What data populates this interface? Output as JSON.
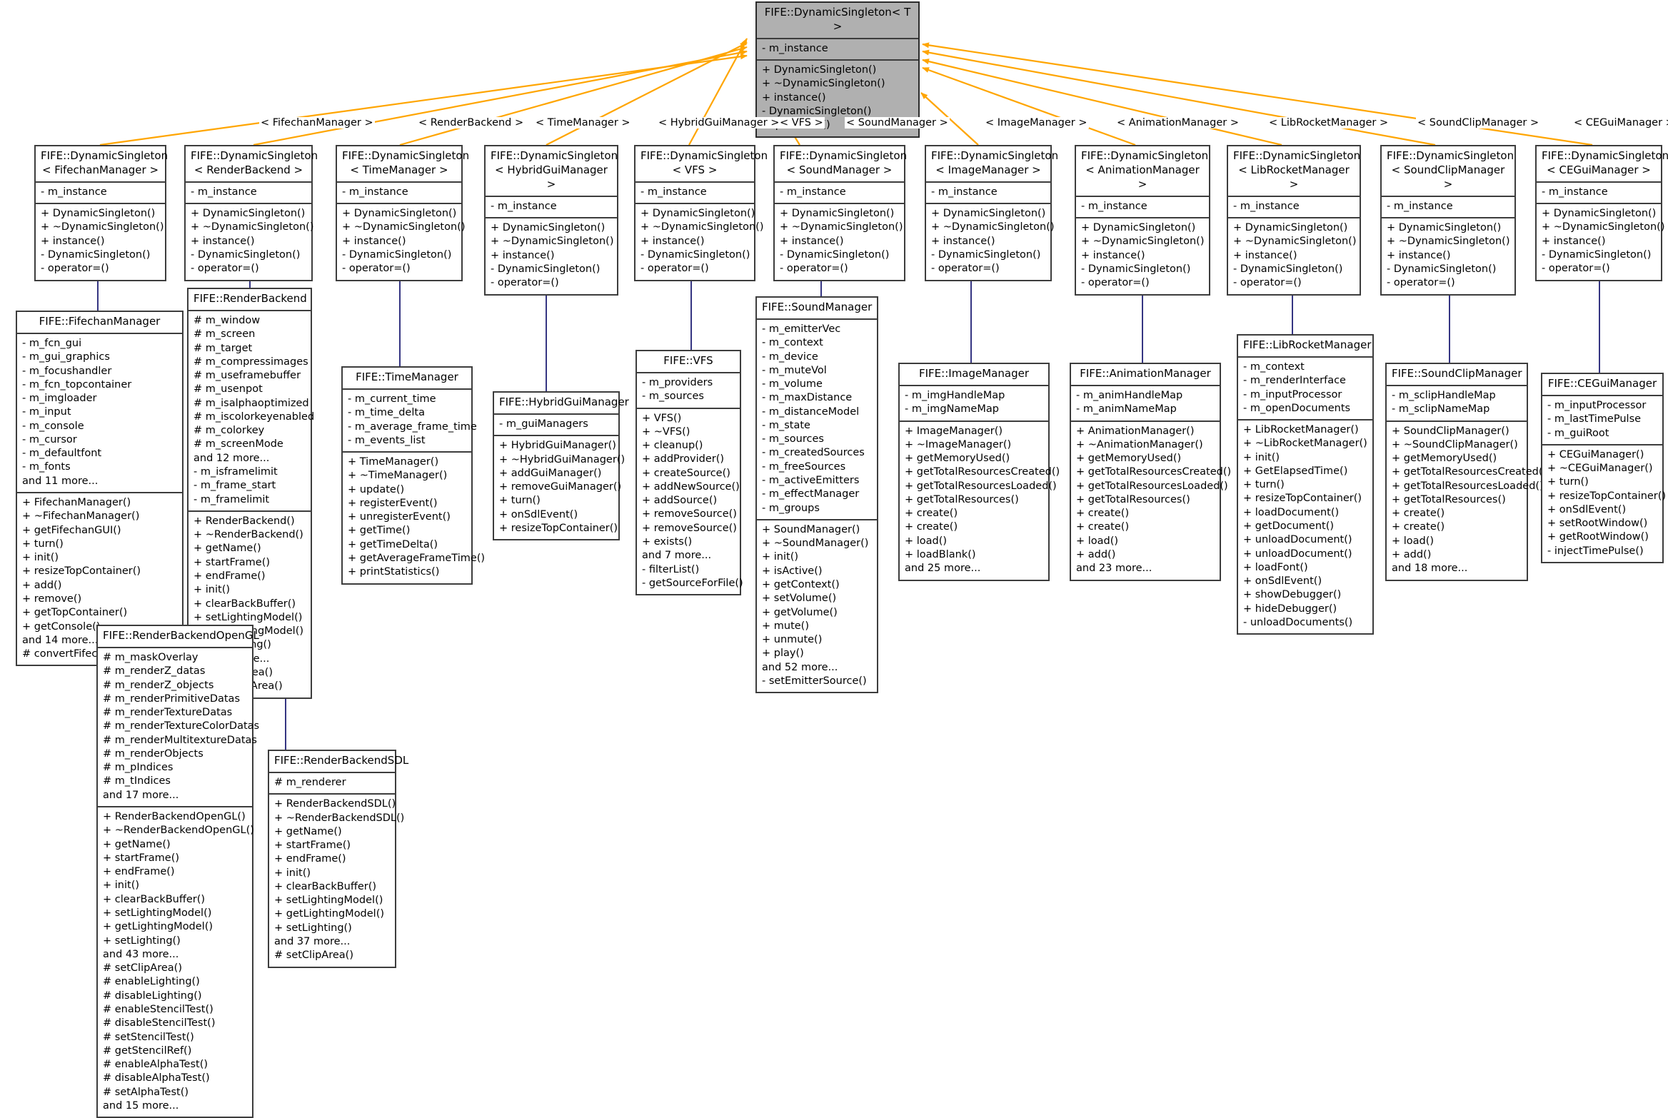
{
  "diagram": {
    "kind": "uml-inheritance-diagram",
    "colors": {
      "template_edge": "#ffa500",
      "inherit_edge": "#353582",
      "node_border": "#3d3d3d",
      "root_fill": "#b0b0b0",
      "node_fill": "#ffffff",
      "text": "#000000"
    }
  },
  "root": {
    "title": "FIFE::DynamicSingleton< T >",
    "attributes": [
      "- m_instance"
    ],
    "methods": [
      "+ DynamicSingleton()",
      "+ ~DynamicSingleton()",
      "+ instance()",
      "- DynamicSingleton()",
      "- operator=()"
    ]
  },
  "template_labels": [
    "< FifechanManager >",
    "< RenderBackend >",
    "< TimeManager >",
    "< HybridGuiManager >",
    "< VFS >",
    "< SoundManager >",
    "< ImageManager >",
    "< AnimationManager >",
    "< LibRocketManager >",
    "< SoundClipManager >",
    "< CEGuiManager >"
  ],
  "specializations": [
    {
      "title": "FIFE::DynamicSingleton\n< FifechanManager >",
      "attributes": [
        "- m_instance"
      ],
      "methods": [
        "+ DynamicSingleton()",
        "+ ~DynamicSingleton()",
        "+ instance()",
        "- DynamicSingleton()",
        "- operator=()"
      ]
    },
    {
      "title": "FIFE::DynamicSingleton\n< RenderBackend >",
      "attributes": [
        "- m_instance"
      ],
      "methods": [
        "+ DynamicSingleton()",
        "+ ~DynamicSingleton()",
        "+ instance()",
        "- DynamicSingleton()",
        "- operator=()"
      ]
    },
    {
      "title": "FIFE::DynamicSingleton\n< TimeManager >",
      "attributes": [
        "- m_instance"
      ],
      "methods": [
        "+ DynamicSingleton()",
        "+ ~DynamicSingleton()",
        "+ instance()",
        "- DynamicSingleton()",
        "- operator=()"
      ]
    },
    {
      "title": "FIFE::DynamicSingleton\n< HybridGuiManager >",
      "attributes": [
        "- m_instance"
      ],
      "methods": [
        "+ DynamicSingleton()",
        "+ ~DynamicSingleton()",
        "+ instance()",
        "- DynamicSingleton()",
        "- operator=()"
      ]
    },
    {
      "title": "FIFE::DynamicSingleton\n< VFS >",
      "attributes": [
        "- m_instance"
      ],
      "methods": [
        "+ DynamicSingleton()",
        "+ ~DynamicSingleton()",
        "+ instance()",
        "- DynamicSingleton()",
        "- operator=()"
      ]
    },
    {
      "title": "FIFE::DynamicSingleton\n< SoundManager >",
      "attributes": [
        "- m_instance"
      ],
      "methods": [
        "+ DynamicSingleton()",
        "+ ~DynamicSingleton()",
        "+ instance()",
        "- DynamicSingleton()",
        "- operator=()"
      ]
    },
    {
      "title": "FIFE::DynamicSingleton\n< ImageManager >",
      "attributes": [
        "- m_instance"
      ],
      "methods": [
        "+ DynamicSingleton()",
        "+ ~DynamicSingleton()",
        "+ instance()",
        "- DynamicSingleton()",
        "- operator=()"
      ]
    },
    {
      "title": "FIFE::DynamicSingleton\n< AnimationManager >",
      "attributes": [
        "- m_instance"
      ],
      "methods": [
        "+ DynamicSingleton()",
        "+ ~DynamicSingleton()",
        "+ instance()",
        "- DynamicSingleton()",
        "- operator=()"
      ]
    },
    {
      "title": "FIFE::DynamicSingleton\n< LibRocketManager >",
      "attributes": [
        "- m_instance"
      ],
      "methods": [
        "+ DynamicSingleton()",
        "+ ~DynamicSingleton()",
        "+ instance()",
        "- DynamicSingleton()",
        "- operator=()"
      ]
    },
    {
      "title": "FIFE::DynamicSingleton\n< SoundClipManager >",
      "attributes": [
        "- m_instance"
      ],
      "methods": [
        "+ DynamicSingleton()",
        "+ ~DynamicSingleton()",
        "+ instance()",
        "- DynamicSingleton()",
        "- operator=()"
      ]
    },
    {
      "title": "FIFE::DynamicSingleton\n< CEGuiManager >",
      "attributes": [
        "- m_instance"
      ],
      "methods": [
        "+ DynamicSingleton()",
        "+ ~DynamicSingleton()",
        "+ instance()",
        "- DynamicSingleton()",
        "- operator=()"
      ]
    }
  ],
  "classes": [
    {
      "id": "fifechanmanager",
      "title": "FIFE::FifechanManager",
      "attributes": [
        "- m_fcn_gui",
        "- m_gui_graphics",
        "- m_focushandler",
        "- m_fcn_topcontainer",
        "- m_imgloader",
        "- m_input",
        "- m_console",
        "- m_cursor",
        "- m_defaultfont",
        "- m_fonts",
        "and 11 more..."
      ],
      "methods": [
        "+ FifechanManager()",
        "+ ~FifechanManager()",
        "+ getFifechanGUI()",
        "+ turn()",
        "+ init()",
        "+ resizeTopContainer()",
        "+ add()",
        "+ remove()",
        "+ getTopContainer()",
        "+ getConsole()",
        "and 14 more...",
        "# convertFifechanKeyToFifeKey()"
      ]
    },
    {
      "id": "renderbackend",
      "title": "FIFE::RenderBackend",
      "attributes": [
        "# m_window",
        "# m_screen",
        "# m_target",
        "# m_compressimages",
        "# m_useframebuffer",
        "# m_usenpot",
        "# m_isalphaoptimized",
        "# m_iscolorkeyenabled",
        "# m_colorkey",
        "# m_screenMode",
        "and 12 more...",
        "- m_isframelimit",
        "- m_frame_start",
        "- m_framelimit"
      ],
      "methods": [
        "+ RenderBackend()",
        "+ ~RenderBackend()",
        "+ getName()",
        "+ startFrame()",
        "+ endFrame()",
        "+ init()",
        "+ clearBackBuffer()",
        "+ setLightingModel()",
        "+ getLightingModel()",
        "+ setLighting()",
        "and 83 more...",
        "# setClipArea()",
        "# clearClipArea()"
      ]
    },
    {
      "id": "renderbackendopengl",
      "title": "FIFE::RenderBackendOpenGL",
      "attributes": [
        "# m_maskOverlay",
        "# m_renderZ_datas",
        "# m_renderZ_objects",
        "# m_renderPrimitiveDatas",
        "# m_renderTextureDatas",
        "# m_renderTextureColorDatas",
        "# m_renderMultitextureDatas",
        "# m_renderObjects",
        "# m_pIndices",
        "# m_tIndices",
        "and 17 more..."
      ],
      "methods": [
        "+ RenderBackendOpenGL()",
        "+ ~RenderBackendOpenGL()",
        "+ getName()",
        "+ startFrame()",
        "+ endFrame()",
        "+ init()",
        "+ clearBackBuffer()",
        "+ setLightingModel()",
        "+ getLightingModel()",
        "+ setLighting()",
        "and 43 more...",
        "# setClipArea()",
        "# enableLighting()",
        "# disableLighting()",
        "# enableStencilTest()",
        "# disableStencilTest()",
        "# setStencilTest()",
        "# getStencilRef()",
        "# enableAlphaTest()",
        "# disableAlphaTest()",
        "# setAlphaTest()",
        "and 15 more..."
      ]
    },
    {
      "id": "renderbackendsdl",
      "title": "FIFE::RenderBackendSDL",
      "attributes": [
        "# m_renderer"
      ],
      "methods": [
        "+ RenderBackendSDL()",
        "+ ~RenderBackendSDL()",
        "+ getName()",
        "+ startFrame()",
        "+ endFrame()",
        "+ init()",
        "+ clearBackBuffer()",
        "+ setLightingModel()",
        "+ getLightingModel()",
        "+ setLighting()",
        "and 37 more...",
        "# setClipArea()"
      ]
    },
    {
      "id": "timemanager",
      "title": "FIFE::TimeManager",
      "attributes": [
        "- m_current_time",
        "- m_time_delta",
        "- m_average_frame_time",
        "- m_events_list"
      ],
      "methods": [
        "+ TimeManager()",
        "+ ~TimeManager()",
        "+ update()",
        "+ registerEvent()",
        "+ unregisterEvent()",
        "+ getTime()",
        "+ getTimeDelta()",
        "+ getAverageFrameTime()",
        "+ printStatistics()"
      ]
    },
    {
      "id": "hybridguimanager",
      "title": "FIFE::HybridGuiManager",
      "attributes": [
        "- m_guiManagers"
      ],
      "methods": [
        "+ HybridGuiManager()",
        "+ ~HybridGuiManager()",
        "+ addGuiManager()",
        "+ removeGuiManager()",
        "+ turn()",
        "+ onSdlEvent()",
        "+ resizeTopContainer()"
      ]
    },
    {
      "id": "vfs",
      "title": "FIFE::VFS",
      "attributes": [
        "- m_providers",
        "- m_sources"
      ],
      "methods": [
        "+ VFS()",
        "+ ~VFS()",
        "+ cleanup()",
        "+ addProvider()",
        "+ createSource()",
        "+ addNewSource()",
        "+ addSource()",
        "+ removeSource()",
        "+ removeSource()",
        "+ exists()",
        "and 7 more...",
        "- filterList()",
        "- getSourceForFile()"
      ]
    },
    {
      "id": "soundmanager",
      "title": "FIFE::SoundManager",
      "attributes": [
        "- m_emitterVec",
        "- m_context",
        "- m_device",
        "- m_muteVol",
        "- m_volume",
        "- m_maxDistance",
        "- m_distanceModel",
        "- m_state",
        "- m_sources",
        "- m_createdSources",
        "- m_freeSources",
        "- m_activeEmitters",
        "- m_effectManager",
        "- m_groups"
      ],
      "methods": [
        "+ SoundManager()",
        "+ ~SoundManager()",
        "+ init()",
        "+ isActive()",
        "+ getContext()",
        "+ setVolume()",
        "+ getVolume()",
        "+ mute()",
        "+ unmute()",
        "+ play()",
        "and 52 more...",
        "- setEmitterSource()"
      ]
    },
    {
      "id": "imagemanager",
      "title": "FIFE::ImageManager",
      "attributes": [
        "- m_imgHandleMap",
        "- m_imgNameMap"
      ],
      "methods": [
        "+ ImageManager()",
        "+ ~ImageManager()",
        "+ getMemoryUsed()",
        "+ getTotalResourcesCreated()",
        "+ getTotalResourcesLoaded()",
        "+ getTotalResources()",
        "+ create()",
        "+ create()",
        "+ load()",
        "+ loadBlank()",
        "and 25 more..."
      ]
    },
    {
      "id": "animationmanager",
      "title": "FIFE::AnimationManager",
      "attributes": [
        "- m_animHandleMap",
        "- m_animNameMap"
      ],
      "methods": [
        "+ AnimationManager()",
        "+ ~AnimationManager()",
        "+ getMemoryUsed()",
        "+ getTotalResourcesCreated()",
        "+ getTotalResourcesLoaded()",
        "+ getTotalResources()",
        "+ create()",
        "+ create()",
        "+ load()",
        "+ add()",
        "and 23 more..."
      ]
    },
    {
      "id": "librocketmanager",
      "title": "FIFE::LibRocketManager",
      "attributes": [
        "- m_context",
        "- m_renderInterface",
        "- m_inputProcessor",
        "- m_openDocuments"
      ],
      "methods": [
        "+ LibRocketManager()",
        "+ ~LibRocketManager()",
        "+ init()",
        "+ GetElapsedTime()",
        "+ turn()",
        "+ resizeTopContainer()",
        "+ loadDocument()",
        "+ getDocument()",
        "+ unloadDocument()",
        "+ unloadDocument()",
        "+ loadFont()",
        "+ onSdlEvent()",
        "+ showDebugger()",
        "+ hideDebugger()",
        "- unloadDocuments()"
      ]
    },
    {
      "id": "soundclipmanager",
      "title": "FIFE::SoundClipManager",
      "attributes": [
        "- m_sclipHandleMap",
        "- m_sclipNameMap"
      ],
      "methods": [
        "+ SoundClipManager()",
        "+ ~SoundClipManager()",
        "+ getMemoryUsed()",
        "+ getTotalResourcesCreated()",
        "+ getTotalResourcesLoaded()",
        "+ getTotalResources()",
        "+ create()",
        "+ create()",
        "+ load()",
        "+ add()",
        "and 18 more..."
      ]
    },
    {
      "id": "ceguimanager",
      "title": "FIFE::CEGuiManager",
      "attributes": [
        "- m_inputProcessor",
        "- m_lastTimePulse",
        "- m_guiRoot"
      ],
      "methods": [
        "+ CEGuiManager()",
        "+ ~CEGuiManager()",
        "+ turn()",
        "+ resizeTopContainer()",
        "+ onSdlEvent()",
        "+ setRootWindow()",
        "+ getRootWindow()",
        "- injectTimePulse()"
      ]
    }
  ]
}
